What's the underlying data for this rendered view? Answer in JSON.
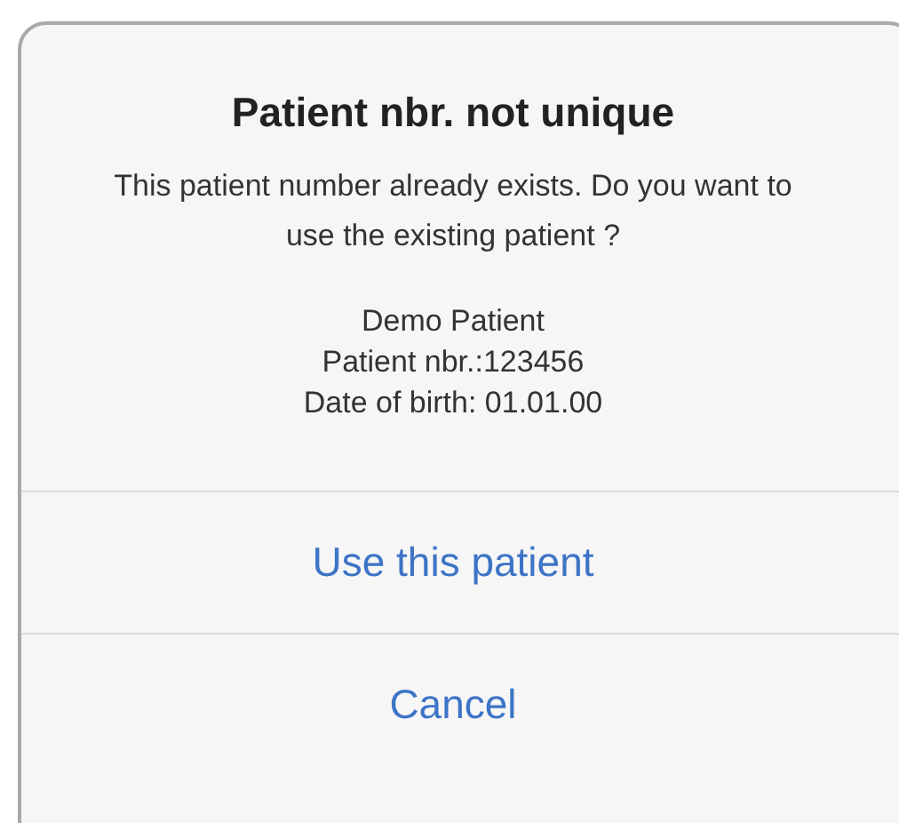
{
  "alert": {
    "title": "Patient nbr. not unique",
    "message": "This patient number already exists. Do you want to use the existing patient ?",
    "details": [
      "Demo Patient",
      "Patient nbr.:123456",
      "Date of birth: 01.01.00"
    ],
    "buttons": [
      {
        "label": "Use this patient"
      },
      {
        "label": "Cancel"
      }
    ]
  }
}
